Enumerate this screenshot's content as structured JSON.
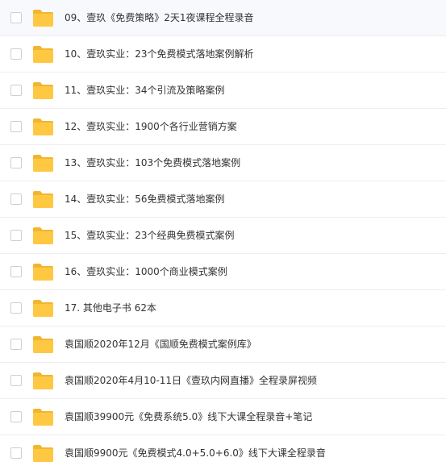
{
  "files": [
    {
      "name": "09、壹玖《免费策略》2天1夜课程全程录音"
    },
    {
      "name": "10、壹玖实业：23个免费模式落地案例解析"
    },
    {
      "name": "11、壹玖实业：34个引流及策略案例"
    },
    {
      "name": "12、壹玖实业：1900个各行业营销方案"
    },
    {
      "name": "13、壹玖实业：103个免费模式落地案例"
    },
    {
      "name": "14、壹玖实业：56免费模式落地案例"
    },
    {
      "name": "15、壹玖实业：23个经典免费模式案例"
    },
    {
      "name": "16、壹玖实业：1000个商业模式案例"
    },
    {
      "name": "17. 其他电子书 62本"
    },
    {
      "name": "袁国顺2020年12月《国顺免费模式案例库》"
    },
    {
      "name": "袁国顺2020年4月10-11日《壹玖内网直播》全程录屏视频"
    },
    {
      "name": "袁国顺39900元《免费系统5.0》线下大课全程录音+笔记"
    },
    {
      "name": "袁国顺9900元《免费模式4.0+5.0+6.0》线下大课全程录音"
    }
  ],
  "icons": {
    "folder": "folder-icon",
    "checkbox": "checkbox"
  },
  "colors": {
    "folder_body": "#ffc842",
    "folder_tab": "#f2b530",
    "text": "#333333",
    "divider": "#eeeeee"
  }
}
